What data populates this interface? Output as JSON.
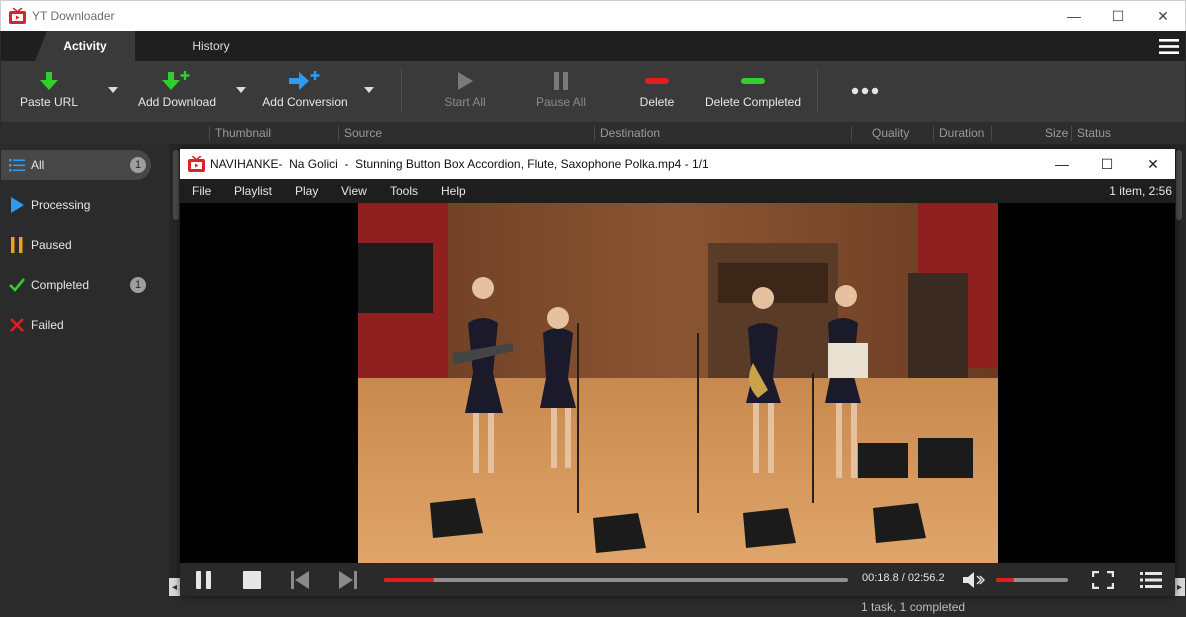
{
  "window": {
    "title": "YT Downloader",
    "minimize": "—",
    "maximize": "☐",
    "close": "✕"
  },
  "tabs": [
    {
      "label": "Activity",
      "active": true
    },
    {
      "label": "History",
      "active": false
    }
  ],
  "toolbar": {
    "paste_url": "Paste URL",
    "add_download": "Add Download",
    "add_conversion": "Add Conversion",
    "start_all": "Start All",
    "pause_all": "Pause All",
    "delete": "Delete",
    "delete_completed": "Delete Completed",
    "more": "more-icon"
  },
  "columns": [
    "Thumbnail",
    "Source",
    "Destination",
    "Quality",
    "Duration",
    "Size",
    "Status"
  ],
  "sidebar": {
    "items": [
      {
        "label": "All",
        "badge": "1",
        "icon": "list-icon",
        "active": true
      },
      {
        "label": "Processing",
        "badge": "",
        "icon": "play-icon",
        "active": false
      },
      {
        "label": "Paused",
        "badge": "",
        "icon": "pause-icon",
        "active": false
      },
      {
        "label": "Completed",
        "badge": "1",
        "icon": "check-icon",
        "active": false
      },
      {
        "label": "Failed",
        "badge": "",
        "icon": "x-icon",
        "active": false
      }
    ]
  },
  "status": "1 task, 1 completed",
  "player": {
    "title": "NAVIHANKE-  Na Golici  -  Stunning Button Box Accordion, Flute, Saxophone Polka.mp4 - 1/1",
    "minimize": "—",
    "maximize": "☐",
    "close": "✕",
    "menu": [
      "File",
      "Playlist",
      "Play",
      "View",
      "Tools",
      "Help"
    ],
    "playlist_info": "1 item, 2:56",
    "time": "00:18.8 / 02:56.2",
    "progress": 0.107,
    "volume": 0.25
  },
  "colors": {
    "accent_red": "#e01e1e",
    "green": "#2fcf2f",
    "blue": "#2f9bf0",
    "orange": "#f0a020"
  }
}
